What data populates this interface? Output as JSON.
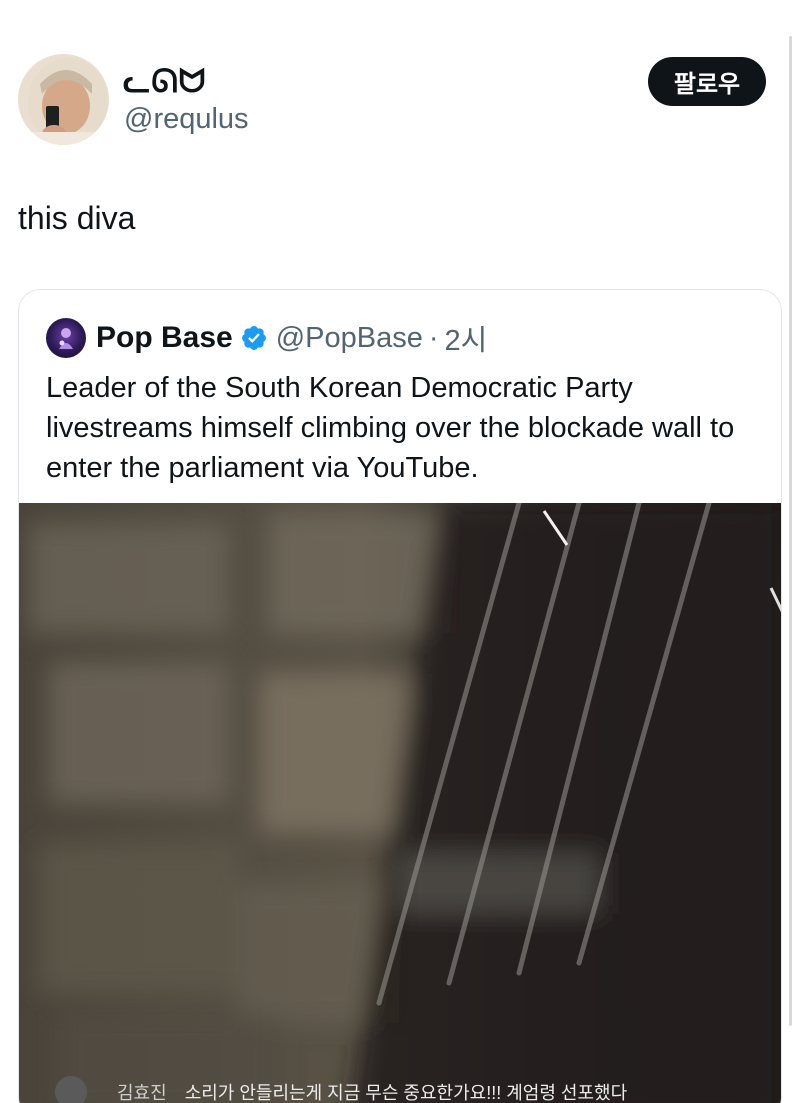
{
  "tweet": {
    "display_name": "ᓚᘏᗢ",
    "handle": "@requlus",
    "follow_label": "팔로우",
    "text": "this diva"
  },
  "quoted": {
    "name": "Pop Base",
    "handle": "@PopBase",
    "separator": "·",
    "time": "2시",
    "text": "Leader of the South Korean Democratic Party livestreams himself climbing over the blockade wall to enter the parliament via YouTube.",
    "media": {
      "caption_user": "김효진",
      "caption_message": "소리가 안들리는게 지금 무슨 중요한가요!!! 계엄령 선포했다"
    }
  },
  "colors": {
    "text": "#0f1419",
    "secondary": "#536471",
    "verified": "#1d9bf0",
    "follow_bg": "#0f1419"
  }
}
